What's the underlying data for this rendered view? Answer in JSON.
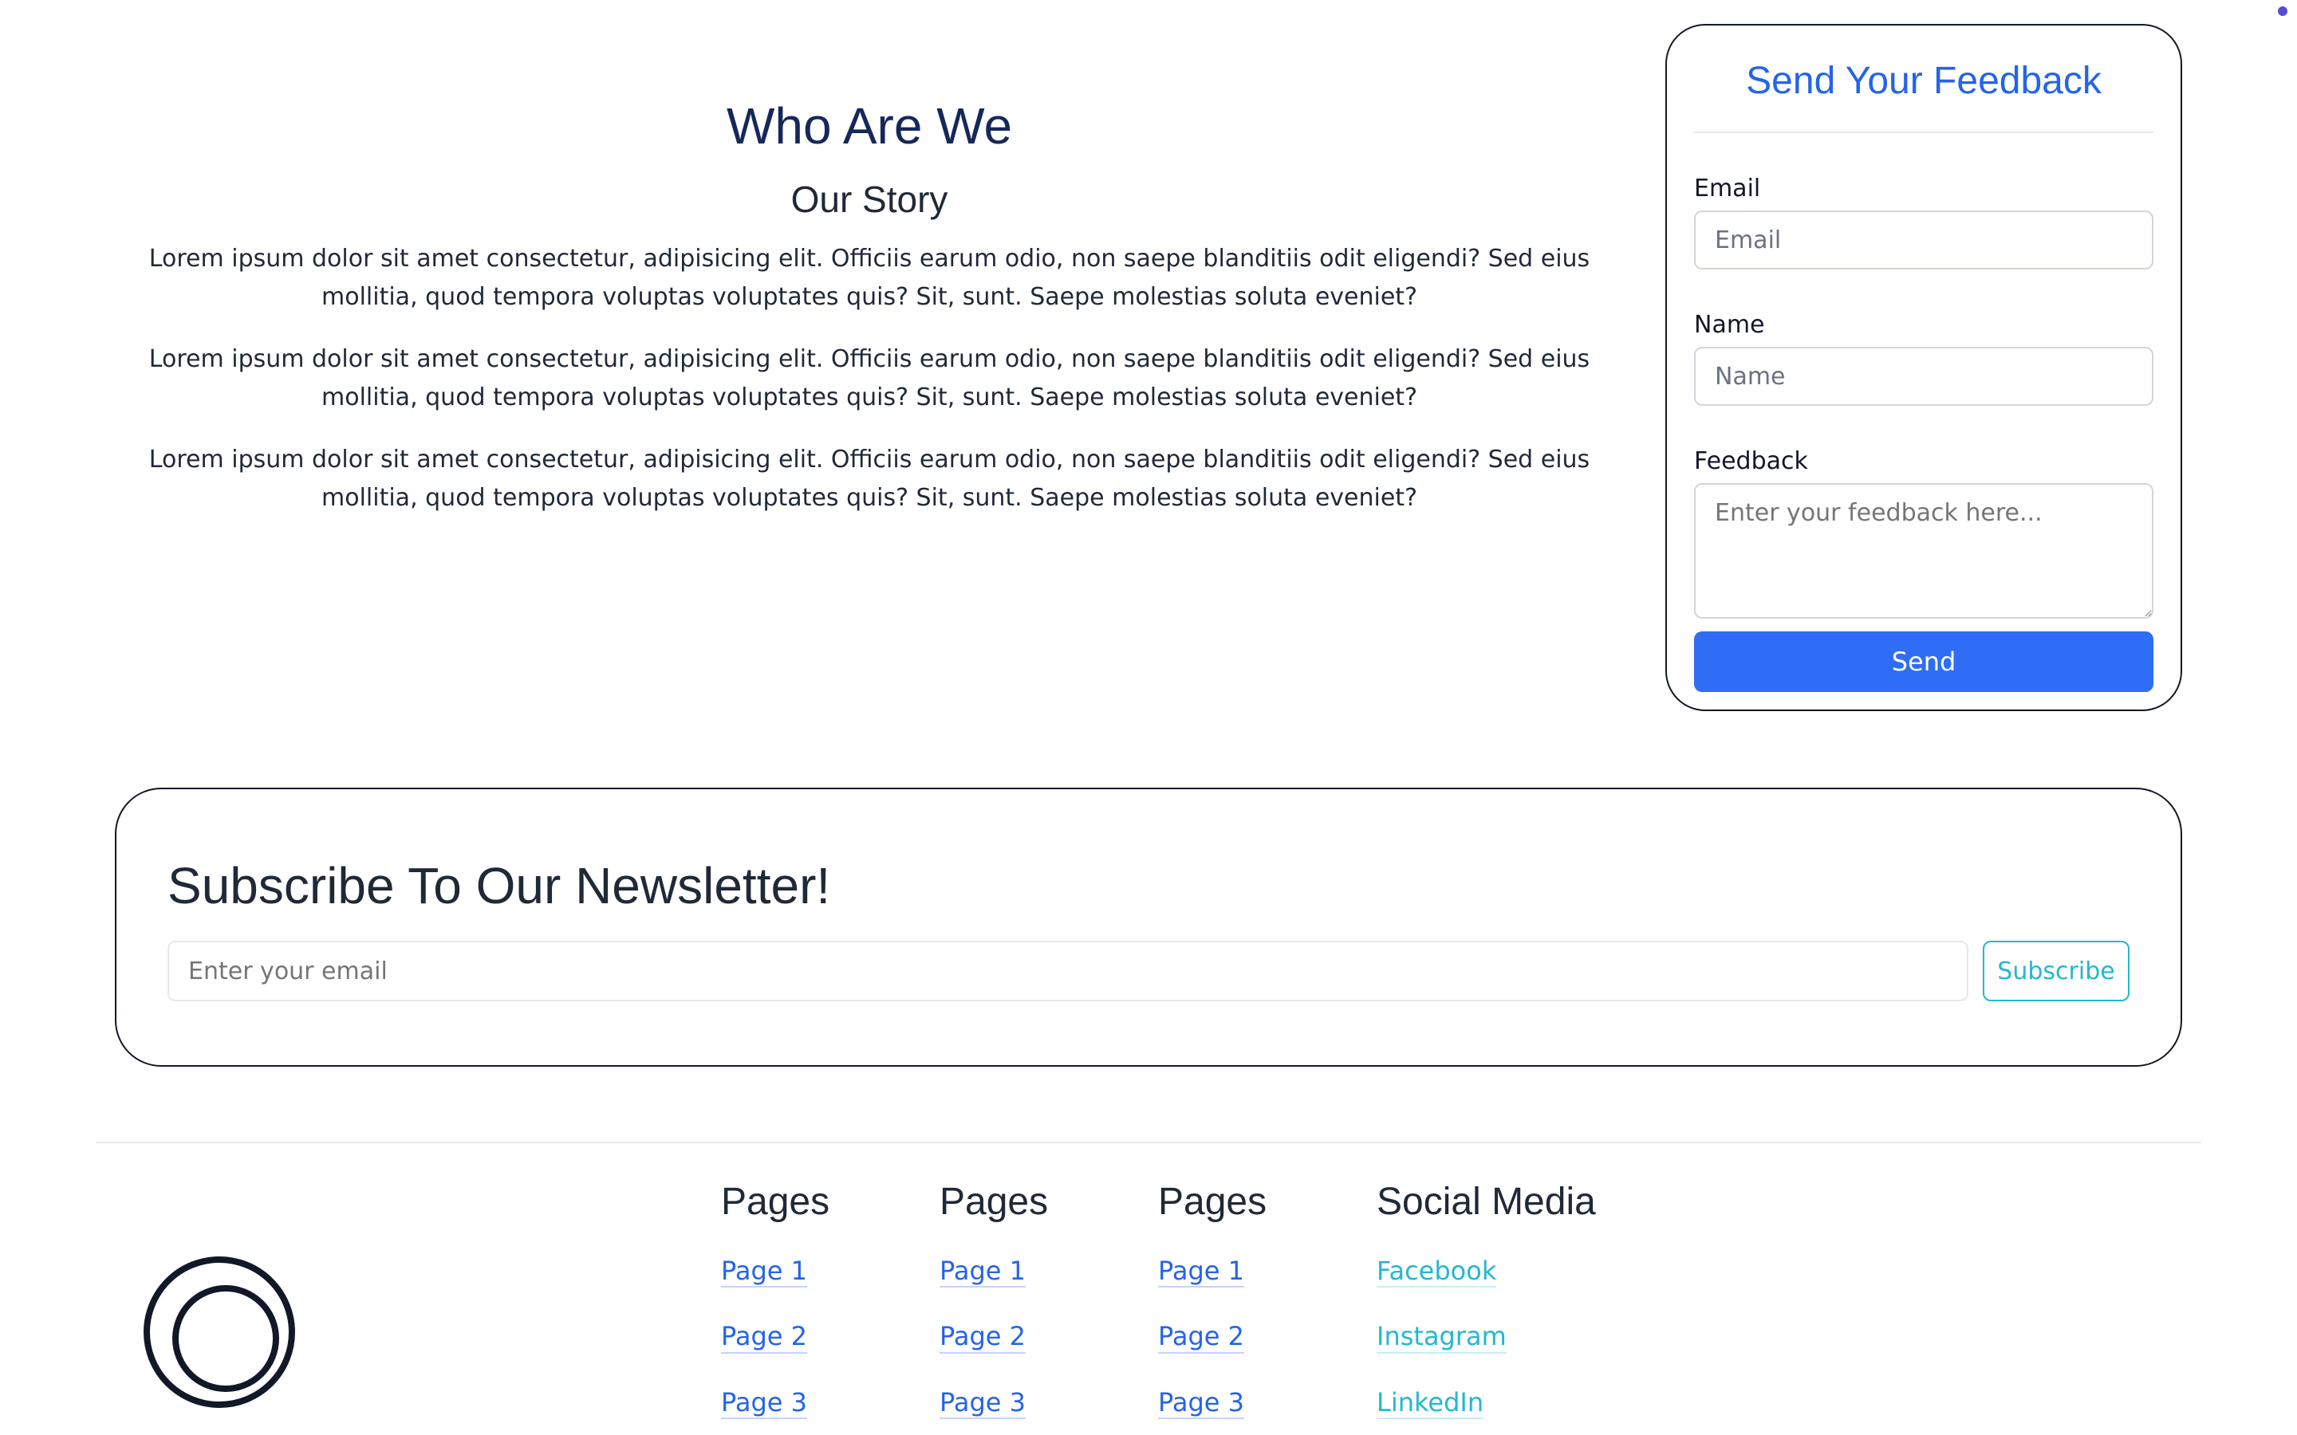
{
  "about": {
    "title": "Who Are We",
    "subtitle": "Our Story",
    "paragraphs": [
      "Lorem ipsum dolor sit amet consectetur, adipisicing elit. Officiis earum odio, non saepe blanditiis odit eligendi? Sed eius mollitia, quod tempora voluptas voluptates quis? Sit, sunt. Saepe molestias soluta eveniet?",
      "Lorem ipsum dolor sit amet consectetur, adipisicing elit. Officiis earum odio, non saepe blanditiis odit eligendi? Sed eius mollitia, quod tempora voluptas voluptates quis? Sit, sunt. Saepe molestias soluta eveniet?",
      "Lorem ipsum dolor sit amet consectetur, adipisicing elit. Officiis earum odio, non saepe blanditiis odit eligendi? Sed eius mollitia, quod tempora voluptas voluptates quis? Sit, sunt. Saepe molestias soluta eveniet?"
    ]
  },
  "feedback": {
    "title": "Send Your Feedback",
    "email_label": "Email",
    "email_placeholder": "Email",
    "name_label": "Name",
    "name_placeholder": "Name",
    "feedback_label": "Feedback",
    "feedback_placeholder": "Enter your feedback here...",
    "send_label": "Send"
  },
  "newsletter": {
    "title": "Subscribe To Our Newsletter!",
    "email_placeholder": "Enter your email",
    "subscribe_label": "Subscribe"
  },
  "footer": {
    "columns": [
      {
        "heading": "Pages",
        "links": [
          "Page 1",
          "Page 2",
          "Page 3"
        ]
      },
      {
        "heading": "Pages",
        "links": [
          "Page 1",
          "Page 2",
          "Page 3"
        ]
      },
      {
        "heading": "Pages",
        "links": [
          "Page 1",
          "Page 2",
          "Page 3"
        ]
      },
      {
        "heading": "Social Media",
        "links": [
          "Facebook",
          "Instagram",
          "LinkedIn"
        ]
      }
    ]
  },
  "colors": {
    "primary_blue": "#2563eb",
    "button_blue": "#2f6df6",
    "teal": "#22b8d2",
    "dark_navy": "#15285a"
  },
  "icons": {
    "logo": "concentric-circles-logo",
    "corner_dot": "dot-indicator"
  }
}
